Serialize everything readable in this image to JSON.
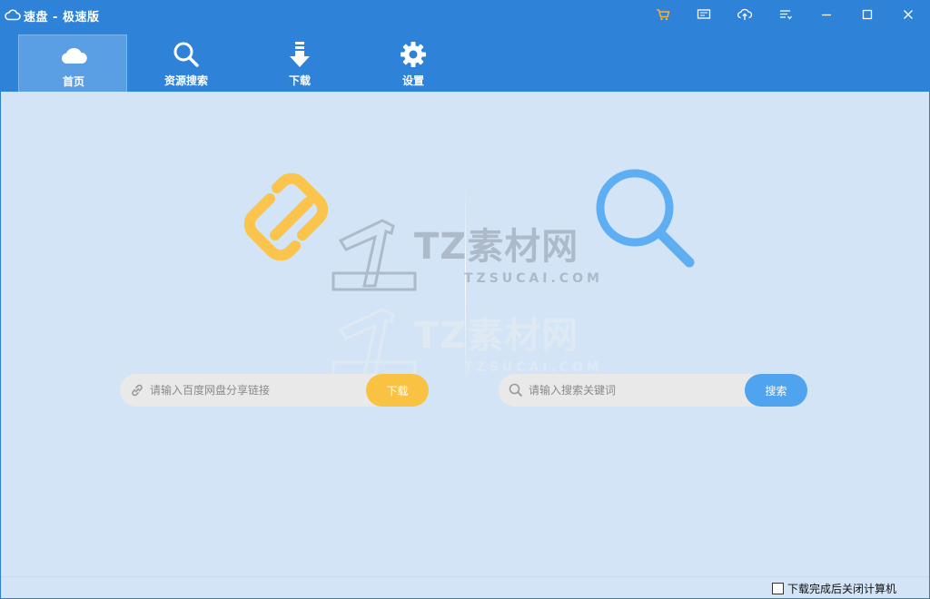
{
  "window": {
    "title": "速盘 - 极速版",
    "app_icon": "cloud-outline-icon",
    "toolbar_icons": [
      "cart-icon",
      "feedback-icon",
      "upload-cloud-icon",
      "log-list-icon"
    ],
    "window_controls": [
      "minimize-icon",
      "maximize-icon",
      "close-icon"
    ],
    "accent_color": "#2e82d8"
  },
  "nav": {
    "items": [
      {
        "label": "首页",
        "icon": "cloud-icon",
        "active": true
      },
      {
        "label": "资源搜索",
        "icon": "search-icon",
        "active": false
      },
      {
        "label": "下载",
        "icon": "download-arrow-icon",
        "active": false
      },
      {
        "label": "设置",
        "icon": "gear-icon",
        "active": false
      }
    ]
  },
  "main": {
    "link_input": {
      "placeholder": "请输入百度网盘分享链接",
      "value": "",
      "icon": "link-icon"
    },
    "download_button": {
      "label": "下载",
      "color": "#f9c243"
    },
    "search_input": {
      "placeholder": "请输入搜索关键词",
      "value": "",
      "icon": "search-icon"
    },
    "search_button": {
      "label": "搜索",
      "color": "#4fa3ef"
    },
    "hero_link_icon": "chain-link-icon",
    "hero_search_icon": "magnifier-icon",
    "watermark": {
      "title": "TZ素材网",
      "subtitle": "TZSUCAI.COM"
    }
  },
  "status": {
    "shutdown_checkbox": {
      "label": "下载完成后关闭计算机",
      "checked": false
    }
  }
}
